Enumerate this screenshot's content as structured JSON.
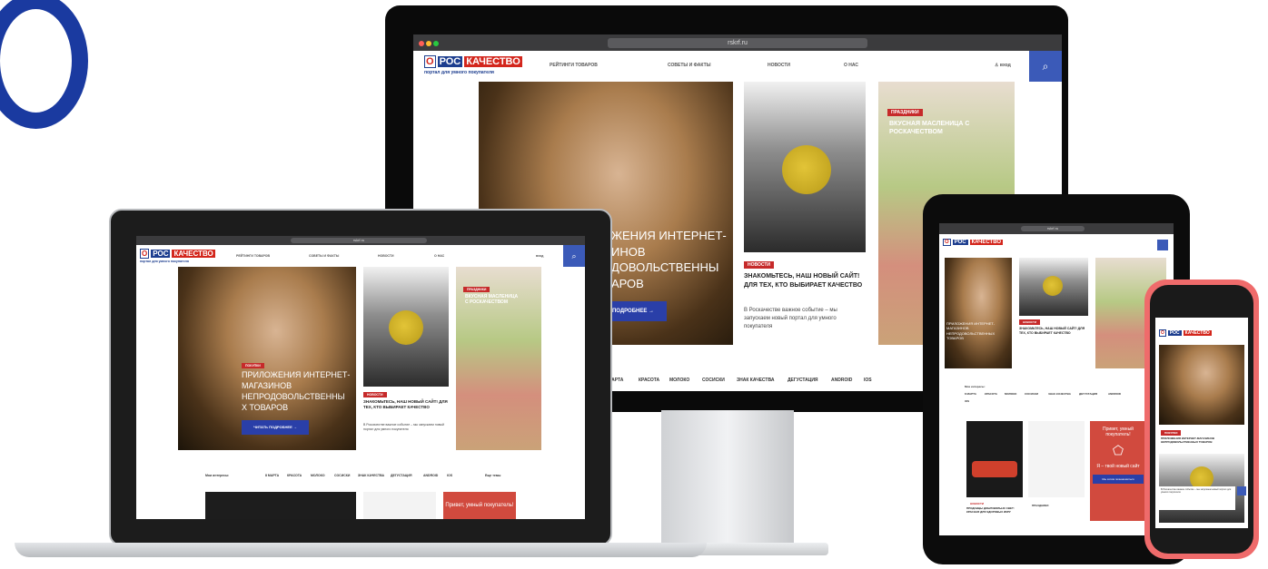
{
  "site": {
    "logo_o": "О",
    "logo_ros": "РОС",
    "logo_kachestvo": "КАЧЕСТВО",
    "logo_subtitle": "портал для умного покупателя"
  },
  "nav": {
    "items": [
      "РЕЙТИНГИ ТОВАРОВ",
      "СОВЕТЫ И ФАКТЫ",
      "НОВОСТИ",
      "О НАС"
    ],
    "login": "вход"
  },
  "hero": {
    "tag": "ПОКУПКИ",
    "title": "ПРИЛОЖЕНИЯ ИНТЕРНЕТ-МАГАЗИНОВ НЕПРОДОВОЛЬСТВЕННЫХ ТОВАРОВ",
    "title_lines": [
      "ПРИЛОЖЕНИЯ ИНТЕРНЕТ-",
      "МАГАЗИНОВ",
      "НЕПРОДОВОЛЬСТВЕННЫ",
      "Х ТОВАРОВ"
    ],
    "monitor_lines": [
      "ЖЕНИЯ ИНТЕРНЕТ-",
      "ИНОВ",
      "ДОВОЛЬСТВЕННЫ",
      "АРОВ"
    ],
    "button": "ЧИТАТЬ ПОДРОБНЕЕ →",
    "monitor_button": "ПОДРОБНЕЕ →"
  },
  "news_card": {
    "tag": "НОВОСТИ",
    "title": "ЗНАКОМЬТЕСЬ, НАШ НОВЫЙ САЙТ! ДЛЯ ТЕХ, КТО ВЫБИРАЕТ КАЧЕСТВО",
    "title_lines": [
      "ЗНАКОМЬТЕСЬ, НАШ НОВЫЙ САЙТ!",
      "ДЛЯ ТЕХ, КТО ВЫБИРАЕТ КАЧЕСТВО"
    ],
    "body": "В Роскачестве важное событие – мы запускаем новый портал для умного покупателя",
    "body_lines": [
      "В Роскачестве важное событие – мы",
      "запускаем новый портал для умного",
      "покупателя"
    ]
  },
  "holiday_card": {
    "tag": "ПРАЗДНИКИ",
    "title": "ВКУСНАЯ МАСЛЕНИЦА С РОСКАЧЕСТВОМ"
  },
  "tags": {
    "label": "Мои интересы:",
    "items": [
      "8 МАРТА",
      "КРАСОТА",
      "МОЛОКО",
      "СОСИСКИ",
      "ЗНАК КАЧЕСТВА",
      "ДЕГУСТАЦИЯ",
      "ANDROID",
      "IOS"
    ],
    "monitor_items": [
      "МАРТА",
      "КРАСОТА",
      "МОЛОКО",
      "СОСИСКИ",
      "ЗНАК КАЧЕСТВА",
      "ДЕГУСТАЦИЯ",
      "ANDROID",
      "IOS"
    ],
    "edit": "Еще темы"
  },
  "promo": {
    "title": "Привет, умный покупатель!",
    "subtitle": "Я – твой новый сайт",
    "button": "Мы хотим познакомиться"
  },
  "lower_cards": {
    "news_tag": "НОВОСТИ",
    "news_title": "ПРОДАВЦЫ ДОБРОВОЛЬНО СВЕТ: КРАСНАЯ ДЛЯ ЗДОРОВЫХ ИКРУ",
    "holiday_tag": "ПРАЗДНИКИ"
  },
  "browser": {
    "url": "rskrf.ru"
  },
  "colors": {
    "brand_blue": "#1d3e8f",
    "brand_red": "#d3261c",
    "accent_button": "#2a3fa8",
    "promo_red": "#d14a3e",
    "phone_body": "#ef6b6b"
  }
}
